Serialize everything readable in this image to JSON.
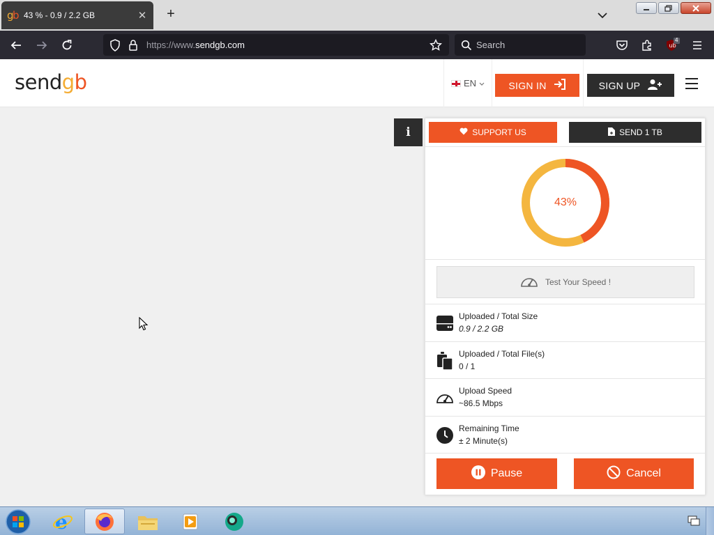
{
  "browser": {
    "tab_title": "43 % - 0.9 / 2.2 GB",
    "new_tab": "+",
    "url_prefix": "https://www.",
    "url_domain": "sendgb.com",
    "search_placeholder": "Search",
    "extension_badge": "4"
  },
  "site": {
    "logo_send": "send",
    "logo_g": "g",
    "logo_b": "b",
    "language": "EN",
    "sign_in": "SIGN IN",
    "sign_up": "SIGN UP",
    "info_label": "i"
  },
  "panel": {
    "support_label": "SUPPORT US",
    "send_label": "SEND 1 TB",
    "progress_percent": 43,
    "progress_label": "43%",
    "speed_test_label": "Test Your Speed !",
    "stats": [
      {
        "label": "Uploaded / Total Size",
        "value": "0.9 / 2.2 GB"
      },
      {
        "label": "Uploaded / Total File(s)",
        "value": "0 / 1"
      },
      {
        "label": "Upload Speed",
        "value": "~86.5 Mbps"
      },
      {
        "label": "Remaining Time",
        "value": "± 2 Minute(s)"
      }
    ],
    "pause_label": "Pause",
    "cancel_label": "Cancel"
  },
  "colors": {
    "accent": "#ee5524",
    "accent_secondary": "#f4b63f",
    "dark": "#2d2d2d"
  },
  "taskbar": {
    "items": [
      "start-orb",
      "internet-explorer-icon",
      "firefox-icon",
      "file-explorer-icon",
      "media-player-icon",
      "messenger-icon"
    ]
  }
}
